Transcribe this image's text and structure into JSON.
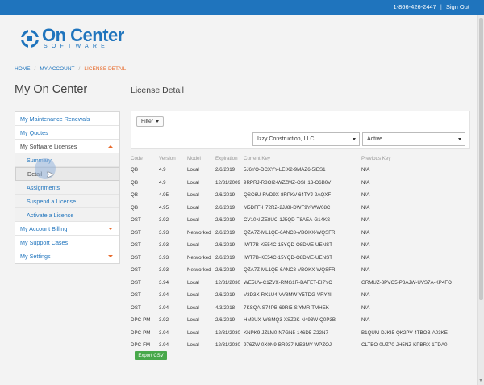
{
  "topbar": {
    "phone": "1-866-426-2447",
    "separator": "|",
    "signout": "Sign Out"
  },
  "logo": {
    "name": "On Center",
    "sub": "SOFTWARE"
  },
  "breadcrumb": {
    "home": "HOME",
    "account": "MY ACCOUNT",
    "current": "LICENSE DETAIL",
    "sep": "/"
  },
  "page_title": "My On Center",
  "section_title": "License Detail",
  "sidebar": {
    "items": [
      {
        "label": "My Maintenance Renewals"
      },
      {
        "label": "My Quotes"
      },
      {
        "label": "My Software Licenses"
      },
      {
        "label": "Summary"
      },
      {
        "label": "Detail"
      },
      {
        "label": "Assignments"
      },
      {
        "label": "Suspend a License"
      },
      {
        "label": "Activate a License"
      },
      {
        "label": "My Account Billing"
      },
      {
        "label": "My Support Cases"
      },
      {
        "label": "My Settings"
      }
    ]
  },
  "filters": {
    "filter_label": "Filter",
    "company": "Izzy Construction, LLC",
    "status": "Active"
  },
  "table": {
    "headers": [
      "Code",
      "Version",
      "Model",
      "Expiration",
      "Current Key",
      "Previous Key"
    ],
    "rows": [
      [
        "QB",
        "4.9",
        "Local",
        "2/6/2019",
        "5J6YO-DCXYY-LEIX2-9MAZ6-5IES1",
        "N/A"
      ],
      [
        "QB",
        "4.9",
        "Local",
        "12/31/2009",
        "9RPRJ-R8OI2-WZZMZ-OSH13-O6B0V",
        "N/A"
      ],
      [
        "QB",
        "4.95",
        "Local",
        "2/6/2019",
        "QSC6U-RVD9X-8RPKV-64TYJ-2AQXF",
        "N/A"
      ],
      [
        "QB",
        "4.95",
        "Local",
        "2/6/2019",
        "M5DFF-H72RZ-2JJ8I-DWF9Y-WW08C",
        "N/A"
      ],
      [
        "OST",
        "3.92",
        "Local",
        "2/6/2019",
        "CV10N-ZE8UC-1J5QD-T8AEA-G14KS",
        "N/A"
      ],
      [
        "OST",
        "3.93",
        "Networked",
        "2/6/2019",
        "QZA7Z-ML1QE-6ANC8-VBOKX-WQSFR",
        "N/A"
      ],
      [
        "OST",
        "3.93",
        "Local",
        "2/6/2019",
        "IWT7B-KE54C-15YQD-O8DME-UENST",
        "N/A"
      ],
      [
        "OST",
        "3.93",
        "Networked",
        "2/6/2019",
        "IWT7B-KE54C-15YQD-O8DME-UENST",
        "N/A"
      ],
      [
        "OST",
        "3.93",
        "Networked",
        "2/6/2019",
        "QZA7Z-ML1QE-6ANC8-VBOKX-WQSFR",
        "N/A"
      ],
      [
        "OST",
        "3.94",
        "Local",
        "12/31/2030",
        "WE5UV-C1ZVX-RMG1R-BAFET-EI7YC",
        "GRMUZ-3PVO5-P3AJW-UVS7A-KP4FO"
      ],
      [
        "OST",
        "3.94",
        "Local",
        "2/6/2019",
        "V3D3X-RX1U4-VV8MW-Y5TDG-VRY4I",
        "N/A"
      ],
      [
        "OST",
        "3.94",
        "Local",
        "4/3/2018",
        "7KSQA-S74PB-69RI5-SIYMR-TMHEK",
        "N/A"
      ],
      [
        "DPC-PM",
        "3.92",
        "Local",
        "2/6/2019",
        "HM2UX-WGMQ3-XSZ2K-N493W-Q0P3B",
        "N/A"
      ],
      [
        "DPC-PM",
        "3.94",
        "Local",
        "12/31/2030",
        "KNPK9-JZLM0-N7GN5-146D5-Z22N7",
        "B1QUM-DJKI5-QK2PV-4TBOB-A03KE"
      ],
      [
        "DPC-FM",
        "3.94",
        "Local",
        "12/31/2030",
        "976ZW-0X0N9-BR937-MB3MY-WPZOJ",
        "CLTBO-0UZ70-JH5NZ-KPBRX-1TDA0"
      ]
    ]
  },
  "export_label": "Export CSV"
}
